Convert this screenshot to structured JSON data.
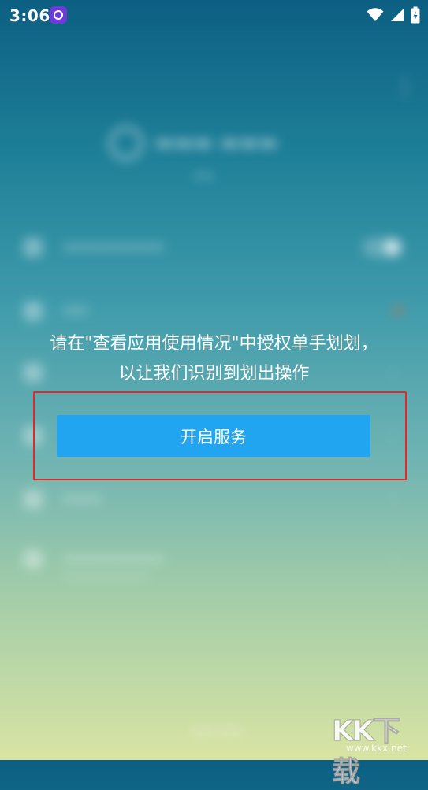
{
  "status_bar": {
    "time": "3:06",
    "icons": [
      "app-notification-icon",
      "wifi-icon",
      "cell-signal-icon",
      "battery-charging-icon"
    ]
  },
  "dialog": {
    "message": "请在\"查看应用使用情况\"中授权单手划划，以让我们识别到划出操作",
    "primary_button_label": "开启服务",
    "highlight_color": "#e5262b",
    "button_color": "#22a5f1"
  },
  "watermark": {
    "logo": "KK下载",
    "url": "www.kkx.net"
  }
}
